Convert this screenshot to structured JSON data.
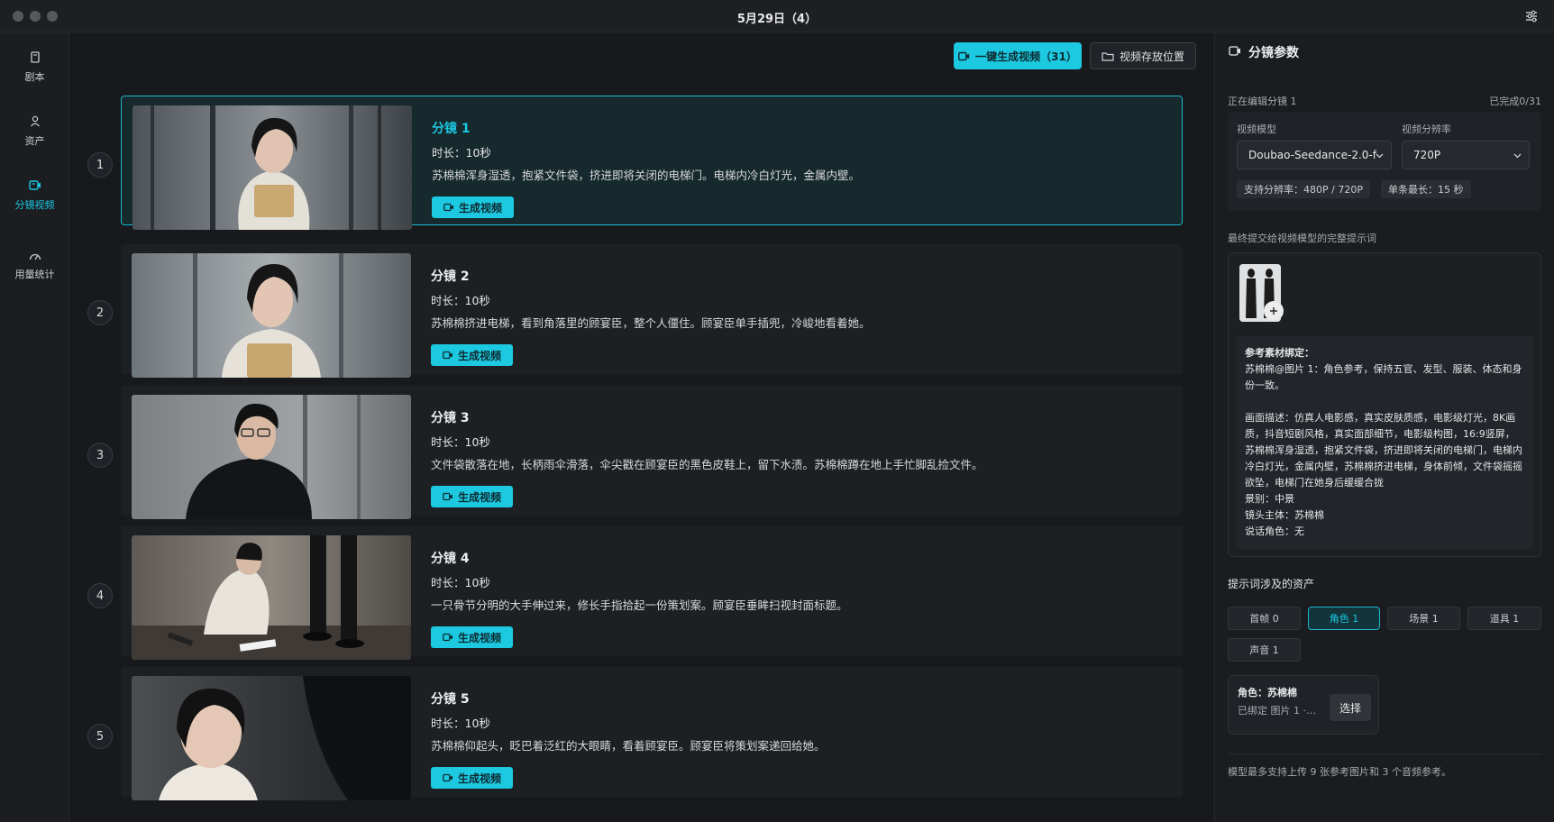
{
  "window": {
    "title": "5月29日（4）"
  },
  "sidebar": {
    "items": [
      {
        "label": "剧本",
        "icon": "document-icon",
        "active": false
      },
      {
        "label": "资产",
        "icon": "user-icon",
        "active": false
      },
      {
        "label": "分镜视频",
        "icon": "video-icon",
        "active": true
      },
      {
        "label": "用量统计",
        "icon": "gauge-icon",
        "active": false
      }
    ]
  },
  "toolbar": {
    "generate_all_label": "一键生成视频（31）",
    "storage_label": "视频存放位置"
  },
  "shots": [
    {
      "number": "1",
      "title": "分镜 1",
      "duration": "时长：10秒",
      "description": "苏棉棉浑身湿透，抱紧文件袋，挤进即将关闭的电梯门。电梯内冷白灯光，金属内壁。",
      "button": "生成视频",
      "active": true
    },
    {
      "number": "2",
      "title": "分镜 2",
      "duration": "时长：10秒",
      "description": "苏棉棉挤进电梯，看到角落里的顾宴臣，整个人僵住。顾宴臣单手插兜，冷峻地看着她。",
      "button": "生成视频",
      "active": false
    },
    {
      "number": "3",
      "title": "分镜 3",
      "duration": "时长：10秒",
      "description": "文件袋散落在地，长柄雨伞滑落，伞尖戳在顾宴臣的黑色皮鞋上，留下水渍。苏棉棉蹲在地上手忙脚乱捡文件。",
      "button": "生成视频",
      "active": false
    },
    {
      "number": "4",
      "title": "分镜 4",
      "duration": "时长：10秒",
      "description": "一只骨节分明的大手伸过来，修长手指拾起一份策划案。顾宴臣垂眸扫视封面标题。",
      "button": "生成视频",
      "active": false
    },
    {
      "number": "5",
      "title": "分镜 5",
      "duration": "时长：10秒",
      "description": "苏棉棉仰起头，眨巴着泛红的大眼睛，看着顾宴臣。顾宴臣将策划案递回给她。",
      "button": "生成视频",
      "active": false
    }
  ],
  "panel": {
    "title": "分镜参数",
    "editing": "正在编辑分镜 1",
    "progress": "已完成0/31",
    "model_label": "视频模型",
    "model_value": "Doubao-Seedance-2.0-f",
    "resolution_label": "视频分辨率",
    "resolution_value": "720P",
    "supported": "支持分辨率：480P / 720P",
    "max_duration": "单条最长：15 秒",
    "prompt_heading": "最终提交给视频模型的完整提示词",
    "prompt_lines": [
      "参考素材绑定：",
      "苏棉棉@图片 1：角色参考，保持五官、发型、服装、体态和身份一致。",
      "",
      "画面描述：仿真人电影感，真实皮肤质感，电影级灯光，8K画质，抖音短剧风格，真实面部细节，电影级构图，16:9竖屏，苏棉棉浑身湿透，抱紧文件袋，挤进即将关闭的电梯门，电梯内冷白灯光，金属内壁，苏棉棉挤进电梯，身体前倾，文件袋摇摇欲坠，电梯门在她身后缓缓合拢",
      "景别：中景",
      "镜头主体：苏棉棉",
      "说话角色：无"
    ],
    "assets_heading": "提示词涉及的资产",
    "asset_tabs": [
      {
        "label": "首帧 0",
        "active": false
      },
      {
        "label": "角色 1",
        "active": true
      },
      {
        "label": "场景 1",
        "active": false
      },
      {
        "label": "道具 1",
        "active": false
      },
      {
        "label": "声音 1",
        "active": false
      }
    ],
    "asset_role": "角色：苏棉棉",
    "asset_bound": "已绑定 图片 1 ·…",
    "asset_select": "选择",
    "footer_note": "模型最多支持上传 9 张参考图片和 3 个音频参考。"
  },
  "colors": {
    "accent": "#1cc9e0",
    "background": "#17191c",
    "card": "#1d2023"
  }
}
